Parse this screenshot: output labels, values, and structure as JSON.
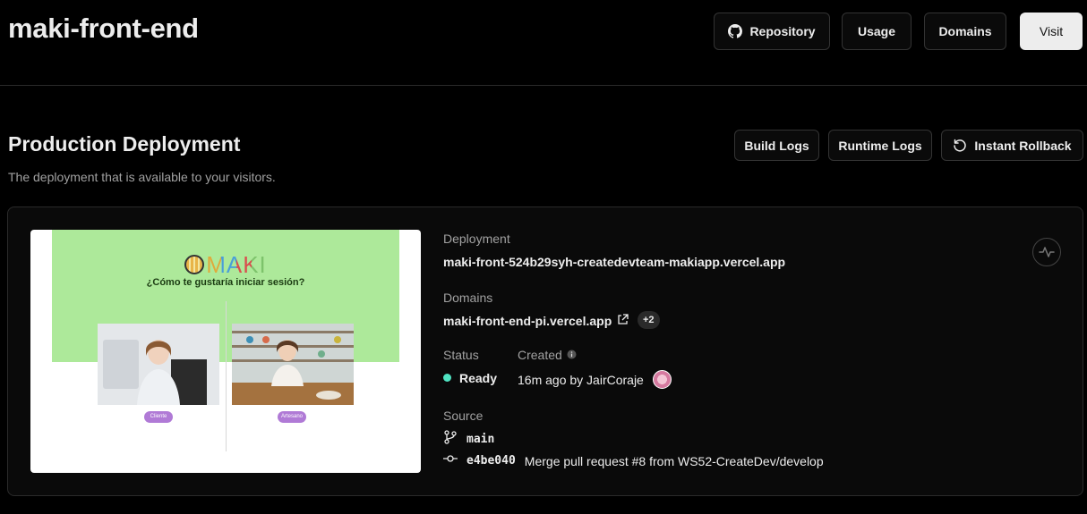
{
  "header": {
    "project_title": "maki-front-end",
    "repository_label": "Repository",
    "usage_label": "Usage",
    "domains_label": "Domains",
    "visit_label": "Visit"
  },
  "production": {
    "title": "Production Deployment",
    "subtitle": "The deployment that is available to your visitors.",
    "build_logs_label": "Build Logs",
    "runtime_logs_label": "Runtime Logs",
    "instant_rollback_label": "Instant Rollback"
  },
  "preview": {
    "logo_text": "MAKI",
    "question": "¿Cómo te gustaría iniciar sesión?",
    "left_pill": "Cliente",
    "right_pill": "Artesano"
  },
  "details": {
    "deployment_label": "Deployment",
    "deployment_url": "maki-front-524b29syh-createdevteam-makiapp.vercel.app",
    "domains_label": "Domains",
    "domain_url": "maki-front-end-pi.vercel.app",
    "domains_extra": "+2",
    "status_label": "Status",
    "status_value": "Ready",
    "created_label": "Created",
    "created_value": "16m ago by JairCoraje",
    "source_label": "Source",
    "branch": "main",
    "commit_hash": "e4be040",
    "commit_message": "Merge pull request #8 from WS52-CreateDev/develop"
  },
  "colors": {
    "status_ready": "#50e3c2",
    "preview_green": "#ade99a",
    "pill_purple": "#b07ad6"
  },
  "icons": [
    "github-icon",
    "rollback-icon",
    "external-link-icon",
    "info-icon",
    "branch-icon",
    "commit-icon",
    "activity-icon"
  ]
}
